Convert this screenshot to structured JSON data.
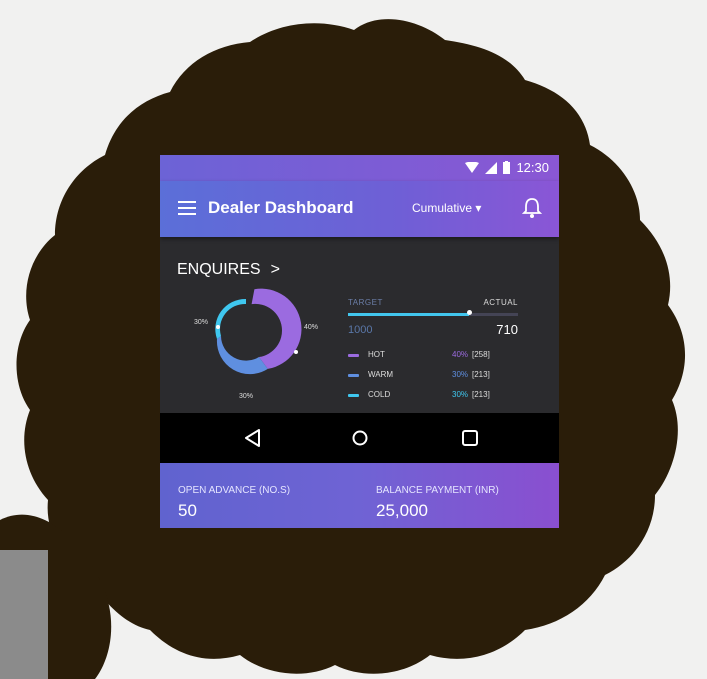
{
  "status_bar": {
    "time": "12:30"
  },
  "app_bar": {
    "title": "Dealer Dashboard",
    "filter": "Cumulative",
    "filter_arrow": "▾"
  },
  "enquires": {
    "title": "ENQUIRES",
    "chevron": ">",
    "donut_labels": [
      "30%",
      "40%",
      "30%"
    ],
    "target_label": "TARGET",
    "actual_label": "ACTUAL",
    "target_value": "1000",
    "actual_value": "710",
    "progress": 0.71,
    "legend": [
      {
        "name": "HOT",
        "percent": "40%",
        "count": "[258]",
        "color": "#9b6be0"
      },
      {
        "name": "WARM",
        "percent": "30%",
        "count": "[213]",
        "color": "#5f8fe0"
      },
      {
        "name": "COLD",
        "percent": "30%",
        "count": "[213]",
        "color": "#3fc7ef"
      }
    ]
  },
  "stats": {
    "open_advance_label": "OPEN ADVANCE (NO.S)",
    "open_advance_value": "50",
    "balance_payment_label": "BALANCE PAYMENT (INR)",
    "balance_payment_value": "25,000"
  },
  "colors": {
    "accent": "#6f5fd6",
    "hot": "#9b6be0",
    "warm": "#5f8fe0",
    "cold": "#3fc7ef",
    "frame": "#2a1d09"
  },
  "icons": [
    "menu-icon",
    "bell-icon",
    "wifi-icon",
    "signal-icon",
    "battery-icon",
    "back-icon",
    "home-icon",
    "recents-icon"
  ]
}
